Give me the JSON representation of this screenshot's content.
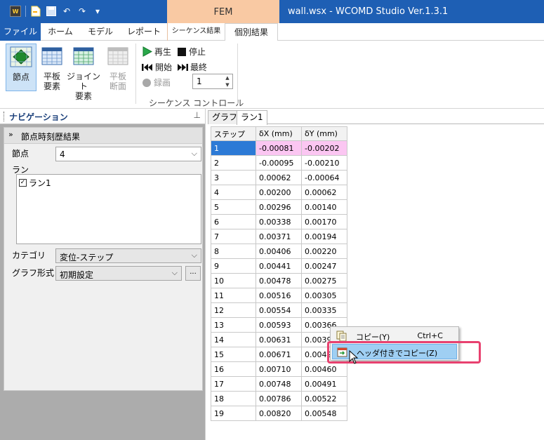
{
  "title": {
    "context_tab": "FEM",
    "window_title": "wall.wsx - WCOMD Studio Ver.1.3.1"
  },
  "tabs": [
    {
      "label": "ファイル"
    },
    {
      "label": "ホーム"
    },
    {
      "label": "モデル"
    },
    {
      "label": "レポート"
    },
    {
      "label": "シーケンス結果"
    },
    {
      "label": "個別結果"
    }
  ],
  "ribbon": {
    "buttons": [
      {
        "label": "節点",
        "icon": "node-icon",
        "selected": true
      },
      {
        "label": "平板 要素",
        "line1": "平板",
        "line2": "要素",
        "icon": "plate-element-icon"
      },
      {
        "label": "ジョイント 要素",
        "line1": "ジョイント",
        "line2": "要素",
        "icon": "joint-element-icon"
      },
      {
        "label": "平板 断面",
        "line1": "平板",
        "line2": "断面",
        "icon": "plate-section-icon",
        "disabled": true
      }
    ],
    "sequence": {
      "play": "再生",
      "stop": "停止",
      "start": "開始",
      "end": "最終",
      "record": "録画",
      "step_value": "1",
      "group_label": "シーケンス コントロール"
    }
  },
  "nav": {
    "title": "ナビゲーション",
    "section_title": "節点時刻歴結果",
    "node_label": "節点",
    "node_value": "4",
    "run_label": "ラン",
    "runs": [
      {
        "label": "ラン1",
        "checked": true
      }
    ],
    "category_label": "カテゴリ",
    "category_value": "変位-ステップ",
    "graph_label": "グラフ形式",
    "graph_value": "初期設定",
    "more_button": "..."
  },
  "content_tabs": [
    "グラフ",
    "ラン1"
  ],
  "table": {
    "headers": [
      "ステップ",
      "δX (mm)",
      "δY (mm)"
    ],
    "rows": [
      [
        "1",
        "-0.00081",
        "-0.00202"
      ],
      [
        "2",
        "-0.00095",
        "-0.00210"
      ],
      [
        "3",
        "0.00062",
        "-0.00064"
      ],
      [
        "4",
        "0.00200",
        "0.00062"
      ],
      [
        "5",
        "0.00296",
        "0.00140"
      ],
      [
        "6",
        "0.00338",
        "0.00170"
      ],
      [
        "7",
        "0.00371",
        "0.00194"
      ],
      [
        "8",
        "0.00406",
        "0.00220"
      ],
      [
        "9",
        "0.00441",
        "0.00247"
      ],
      [
        "10",
        "0.00478",
        "0.00275"
      ],
      [
        "11",
        "0.00516",
        "0.00305"
      ],
      [
        "12",
        "0.00554",
        "0.00335"
      ],
      [
        "13",
        "0.00593",
        "0.00366"
      ],
      [
        "14",
        "0.00631",
        "0.00397"
      ],
      [
        "15",
        "0.00671",
        "0.00428"
      ],
      [
        "16",
        "0.00710",
        "0.00460"
      ],
      [
        "17",
        "0.00748",
        "0.00491"
      ],
      [
        "18",
        "0.00786",
        "0.00522"
      ],
      [
        "19",
        "0.00820",
        "0.00548"
      ]
    ]
  },
  "context_menu": {
    "copy_label": "コピー(Y)",
    "copy_shortcut": "Ctrl+C",
    "copy_header_label": "ヘッダ付きでコピー(Z)"
  },
  "colors": {
    "title_bar": "#1e5fb4",
    "context_tab": "#f9c9a3",
    "selected_cell": "#2c7ad6",
    "highlight_cell": "#fbc6f2",
    "menu_highlight": "#9fcff3",
    "callout_border": "#e8416f"
  }
}
